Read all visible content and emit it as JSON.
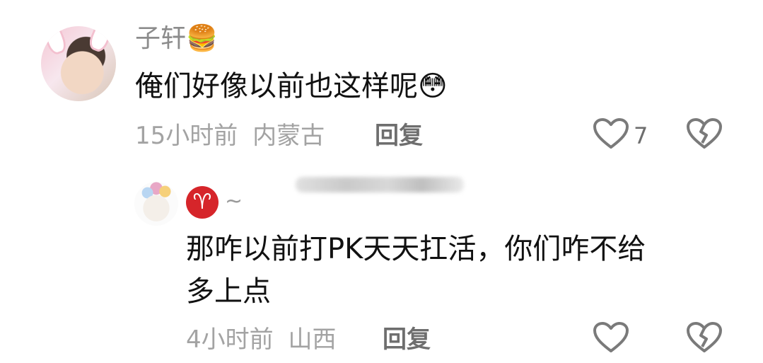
{
  "comment": {
    "username": "子轩",
    "username_emoji": "🍔",
    "text": "俺们好像以前也这样呢",
    "text_emoji": "😳",
    "time": "15小时前",
    "location": "内蒙古",
    "reply_label": "回复",
    "like_count": "7"
  },
  "reply_comment": {
    "username_badge": "♈",
    "username_suffix": "~",
    "text_line1": "那咋以前打PK天天扛活，你们咋不给",
    "text_line2": "多上点",
    "time": "4小时前",
    "location": "山西",
    "reply_label": "回复"
  },
  "colors": {
    "meta": "#a3a3a3",
    "text": "#111111",
    "badge": "#d6252a"
  },
  "icons": [
    "heart-icon",
    "broken-heart-icon"
  ]
}
